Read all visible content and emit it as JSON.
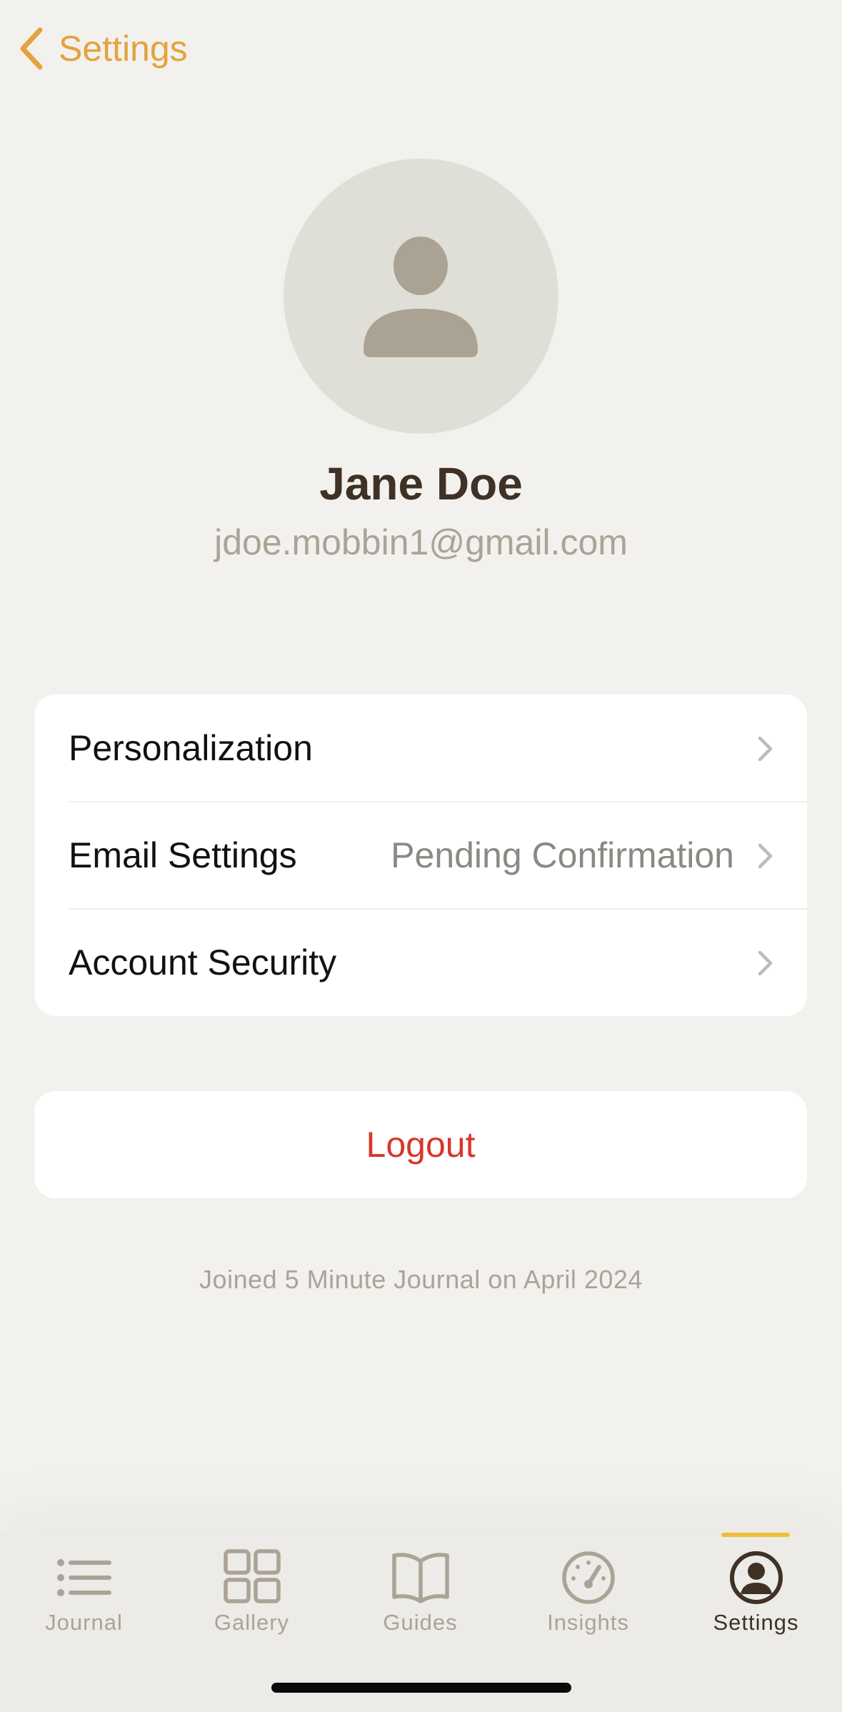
{
  "nav": {
    "back_label": "Settings"
  },
  "profile": {
    "name": "Jane Doe",
    "email": "jdoe.mobbin1@gmail.com",
    "avatar_icon": "person-icon"
  },
  "settings_list": [
    {
      "label": "Personalization",
      "value": ""
    },
    {
      "label": "Email Settings",
      "value": "Pending Confirmation"
    },
    {
      "label": "Account Security",
      "value": ""
    }
  ],
  "logout_label": "Logout",
  "joined_text": "Joined 5 Minute Journal on April 2024",
  "tabs": [
    {
      "label": "Journal",
      "icon": "list-icon",
      "active": false
    },
    {
      "label": "Gallery",
      "icon": "grid-icon",
      "active": false
    },
    {
      "label": "Guides",
      "icon": "book-icon",
      "active": false
    },
    {
      "label": "Insights",
      "icon": "gauge-icon",
      "active": false
    },
    {
      "label": "Settings",
      "icon": "account-circle-icon",
      "active": true
    }
  ],
  "colors": {
    "background": "#f2f1ee",
    "accent": "#e3a33d",
    "tab_indicator": "#f0bc3d",
    "destructive": "#d9362b",
    "primary_text": "#3f3126",
    "muted_text": "#aba396"
  }
}
